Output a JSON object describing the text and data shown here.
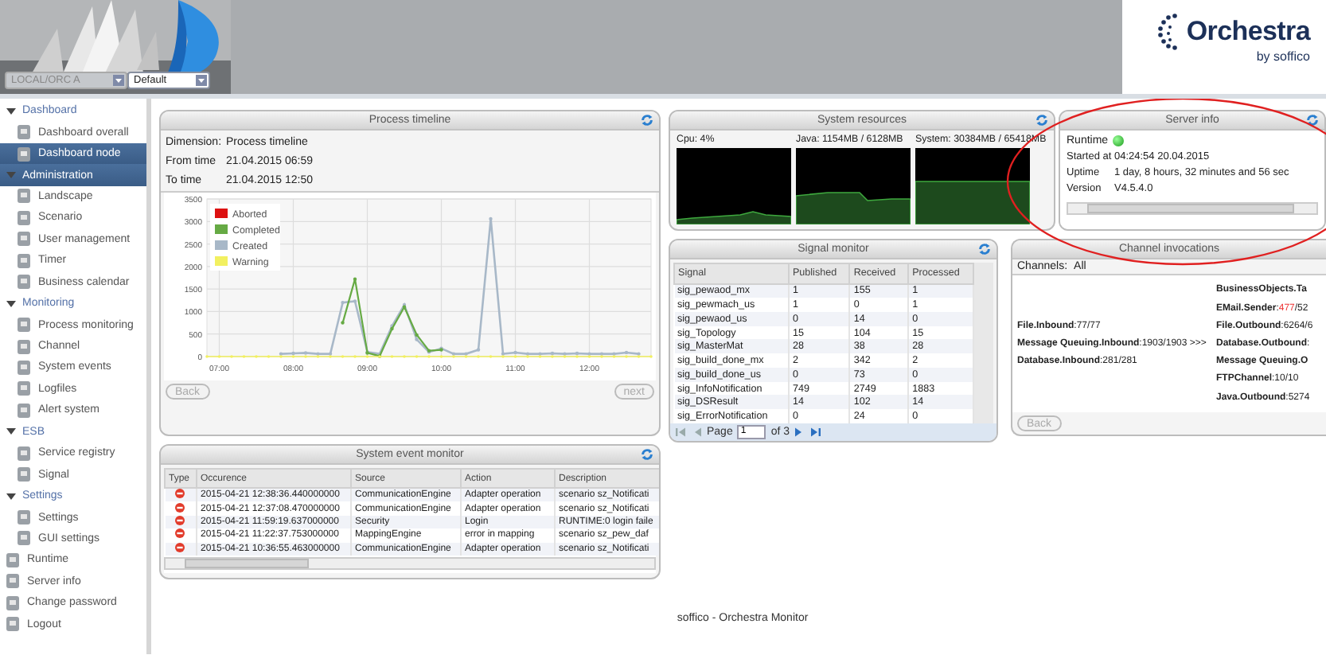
{
  "header": {
    "node_select": {
      "value": "LOCAL/ORC A",
      "disabled": true
    },
    "view_select": {
      "value": "Default",
      "disabled": false
    },
    "logo": {
      "name": "Orchestra",
      "tagline": "by soffico"
    }
  },
  "sidebar": {
    "groups": [
      {
        "label": "Dashboard",
        "expanded": true,
        "selected": false,
        "items": [
          {
            "label": "Dashboard overall",
            "selected": false
          },
          {
            "label": "Dashboard node",
            "selected": true
          }
        ]
      },
      {
        "label": "Administration",
        "expanded": true,
        "selected": true,
        "items": [
          {
            "label": "Landscape",
            "selected": false
          },
          {
            "label": "Scenario",
            "selected": false
          },
          {
            "label": "User management",
            "selected": false
          },
          {
            "label": "Timer",
            "selected": false
          },
          {
            "label": "Business calendar",
            "selected": false
          }
        ]
      },
      {
        "label": "Monitoring",
        "expanded": true,
        "selected": false,
        "items": [
          {
            "label": "Process monitoring",
            "selected": false
          },
          {
            "label": "Channel",
            "selected": false
          },
          {
            "label": "System events",
            "selected": false
          },
          {
            "label": "Logfiles",
            "selected": false
          },
          {
            "label": "Alert system",
            "selected": false
          }
        ]
      },
      {
        "label": "ESB",
        "expanded": true,
        "selected": false,
        "items": [
          {
            "label": "Service registry",
            "selected": false
          },
          {
            "label": "Signal",
            "selected": false
          }
        ]
      },
      {
        "label": "Settings",
        "expanded": true,
        "selected": false,
        "items": [
          {
            "label": "Settings",
            "selected": false
          },
          {
            "label": "GUI settings",
            "selected": false
          }
        ]
      }
    ],
    "links": [
      {
        "label": "Runtime",
        "selected": false
      },
      {
        "label": "Server info",
        "selected": false
      },
      {
        "label": "Change password",
        "selected": false
      },
      {
        "label": "Logout",
        "selected": false
      }
    ]
  },
  "process_timeline": {
    "title": "Process timeline",
    "fields": [
      {
        "label": "Dimension:",
        "value": "Process timeline"
      },
      {
        "label": "From time",
        "value": "21.04.2015 06:59"
      },
      {
        "label": "To time",
        "value": "21.04.2015 12:50"
      }
    ],
    "chart_data": {
      "type": "line",
      "x": [
        410,
        420,
        430,
        440,
        450,
        460,
        470,
        480,
        490,
        500,
        510,
        520,
        530,
        540,
        550,
        560,
        570,
        580,
        590,
        600,
        610,
        620,
        630,
        640,
        650,
        660,
        670,
        680,
        690,
        700,
        710,
        720,
        730,
        740,
        750,
        760,
        770
      ],
      "grid": true,
      "legend": true,
      "xlim": [
        410,
        770
      ],
      "ylim": [
        0,
        3500
      ],
      "xticks": [
        {
          "value": 420,
          "label": "07:00"
        },
        {
          "value": 480,
          "label": "08:00"
        },
        {
          "value": 540,
          "label": "09:00"
        },
        {
          "value": 600,
          "label": "10:00"
        },
        {
          "value": 660,
          "label": "11:00"
        },
        {
          "value": 720,
          "label": "12:00"
        }
      ],
      "yticks": [
        0,
        500,
        1000,
        1500,
        2000,
        2500,
        3000,
        3500
      ],
      "series": [
        {
          "name": "Aborted",
          "color": "#dd1111",
          "values": [
            null,
            null,
            null,
            null,
            null,
            null,
            null,
            null,
            null,
            null,
            null,
            null,
            null,
            null,
            null,
            null,
            null,
            null,
            null,
            null,
            null,
            null,
            null,
            null,
            null,
            null,
            null,
            null,
            null,
            null,
            null,
            null,
            null,
            null,
            null,
            null,
            null
          ]
        },
        {
          "name": "Completed",
          "color": "#66aa44",
          "values": [
            null,
            null,
            null,
            null,
            null,
            null,
            null,
            null,
            null,
            null,
            null,
            750,
            1720,
            80,
            10,
            620,
            1100,
            480,
            130,
            150,
            null,
            null,
            null,
            null,
            null,
            null,
            null,
            null,
            null,
            null,
            null,
            null,
            null,
            null,
            null,
            null,
            null
          ]
        },
        {
          "name": "Created",
          "color": "#a8b8c8",
          "values": [
            null,
            null,
            null,
            null,
            null,
            null,
            60,
            70,
            80,
            60,
            60,
            1200,
            1230,
            100,
            60,
            680,
            1150,
            380,
            100,
            180,
            60,
            60,
            150,
            3060,
            60,
            90,
            60,
            60,
            70,
            60,
            70,
            60,
            60,
            60,
            90,
            60,
            null
          ]
        },
        {
          "name": "Warning",
          "color": "#f2f060",
          "values": [
            0,
            0,
            0,
            0,
            0,
            0,
            0,
            0,
            0,
            0,
            0,
            0,
            0,
            0,
            0,
            0,
            0,
            0,
            0,
            0,
            0,
            0,
            0,
            0,
            0,
            0,
            0,
            0,
            0,
            0,
            0,
            0,
            0,
            0,
            0,
            0,
            0
          ]
        }
      ]
    },
    "buttons": [
      {
        "label": "Back",
        "disabled": true
      },
      {
        "label": "next",
        "disabled": true
      }
    ]
  },
  "system_resources": {
    "title": "System resources",
    "gauges": [
      {
        "label": "Cpu: 4%"
      },
      {
        "label": "Java: 1154MB / 6128MB"
      },
      {
        "label": "System: 30384MB / 65418MB"
      }
    ]
  },
  "server_info": {
    "title": "Server info",
    "runtime": {
      "label": "Runtime",
      "running": true
    },
    "started": "Started at 04:24:54 20.04.2015",
    "lines": [
      {
        "label": "Uptime",
        "value": "1 day, 8 hours, 32 minutes and 56 sec"
      },
      {
        "label": "Version",
        "value": "V4.5.4.0"
      }
    ]
  },
  "signal_monitor": {
    "title": "Signal monitor",
    "columns": [
      "Signal",
      "Published",
      "Received",
      "Processed"
    ],
    "rows": [
      [
        "sig_pewaod_mx",
        "1",
        "155",
        "1"
      ],
      [
        "sig_pewmach_us",
        "1",
        "0",
        "1"
      ],
      [
        "sig_pewaod_us",
        "0",
        "14",
        "0"
      ],
      [
        "sig_Topology",
        "15",
        "104",
        "15"
      ],
      [
        "sig_MasterMat",
        "28",
        "38",
        "28"
      ],
      [
        "sig_build_done_mx",
        "2",
        "342",
        "2"
      ],
      [
        "sig_build_done_us",
        "0",
        "73",
        "0"
      ],
      [
        "sig_InfoNotification",
        "749",
        "2749",
        "1883"
      ],
      [
        "sig_DSResult",
        "14",
        "102",
        "14"
      ],
      [
        "sig_ErrorNotification",
        "0",
        "24",
        "0"
      ]
    ],
    "pager": {
      "label": "Page",
      "value": "1",
      "total": "of 3"
    }
  },
  "channel_invocations": {
    "title": "Channel invocations",
    "filter_label": "Channels:",
    "filter_value": "All",
    "inbound": [
      {
        "name": "File.Inbound",
        "value": ":77/77"
      },
      {
        "name": "Message Queuing.Inbound",
        "value": ":1903/1903 >>>"
      },
      {
        "name": "Database.Inbound",
        "value": ":281/281"
      }
    ],
    "outbound": [
      {
        "name": "BusinessObjects.Ta"
      },
      {
        "name": "EMail.Sender",
        "value": ":",
        "alert": "477",
        "rest": "/52"
      },
      {
        "name": "File.Outbound",
        "value": ":6264/6"
      },
      {
        "name": "Database.Outbound",
        "value": ":"
      },
      {
        "name": "Message Queuing.O"
      },
      {
        "name": "FTPChannel",
        "value": ":10/10"
      },
      {
        "name": "Java.Outbound",
        "value": ":5274"
      }
    ],
    "button": {
      "label": "Back",
      "disabled": true
    }
  },
  "event_monitor": {
    "title": "System event monitor",
    "type_header": "Type",
    "columns": [
      "Occurence",
      "Source",
      "Action",
      "Description"
    ],
    "rows": [
      {
        "kind": "error",
        "cells": [
          "2015-04-21 12:38:36.440000000",
          "CommunicationEngine",
          "Adapter operation",
          "scenario sz_Notificati"
        ]
      },
      {
        "kind": "error",
        "cells": [
          "2015-04-21 12:37:08.470000000",
          "CommunicationEngine",
          "Adapter operation",
          "scenario sz_Notificati"
        ]
      },
      {
        "kind": "error",
        "cells": [
          "2015-04-21 11:59:19.637000000",
          "Security",
          "Login",
          "RUNTIME:0 login faile"
        ]
      },
      {
        "kind": "error",
        "cells": [
          "2015-04-21 11:22:37.753000000",
          "MappingEngine",
          "error in mapping",
          "scenario sz_pew_daf"
        ]
      },
      {
        "kind": "error",
        "cells": [
          "2015-04-21 10:36:55.463000000",
          "CommunicationEngine",
          "Adapter operation",
          "scenario sz_Notificati"
        ]
      }
    ]
  },
  "annotation": {
    "kind": "ellipse"
  },
  "footer": "soffico - Orchestra Monitor"
}
